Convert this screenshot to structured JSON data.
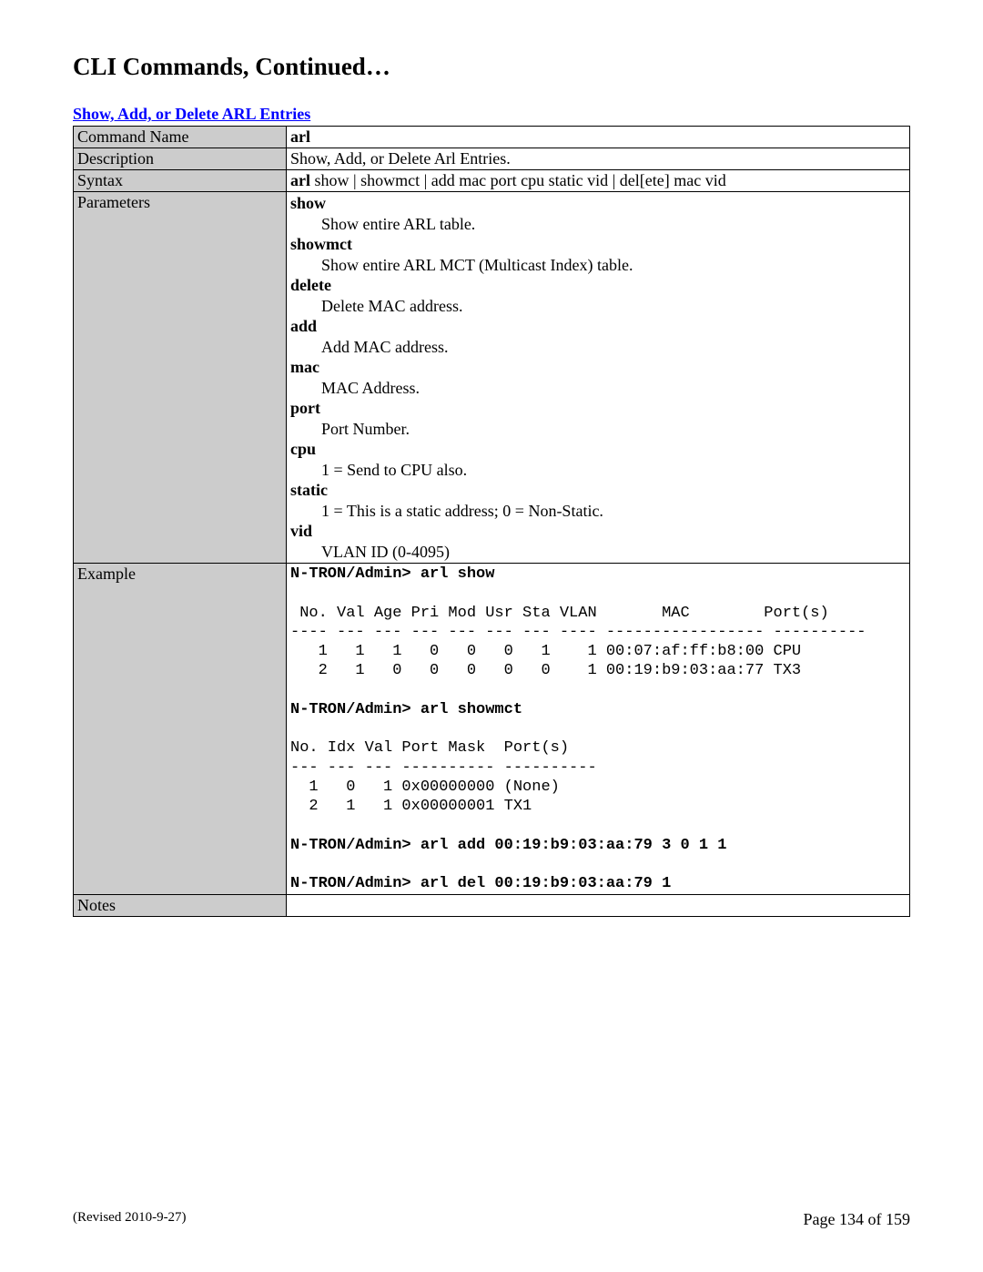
{
  "page_title": "CLI Commands, Continued…",
  "section_link": "Show, Add, or Delete ARL Entries",
  "rows": {
    "command_name": {
      "label": "Command Name",
      "value": "arl"
    },
    "description": {
      "label": "Description",
      "value": "Show, Add, or Delete Arl Entries."
    },
    "syntax": {
      "label": "Syntax",
      "bold": "arl",
      "rest": "  show | showmct | add mac port cpu static vid | del[ete] mac vid"
    },
    "parameters": {
      "label": "Parameters",
      "items": [
        {
          "name": "show",
          "desc": "Show entire ARL table."
        },
        {
          "name": "showmct",
          "desc": "Show entire ARL MCT (Multicast Index) table."
        },
        {
          "name": "delete",
          "desc": "Delete MAC address."
        },
        {
          "name": "add",
          "desc": "Add MAC address."
        },
        {
          "name": "mac",
          "desc": "MAC Address."
        },
        {
          "name": "port",
          "desc": "Port Number."
        },
        {
          "name": "cpu",
          "desc": "1 = Send to CPU also."
        },
        {
          "name": "static",
          "desc": "1 = This is a static address; 0 = Non-Static."
        },
        {
          "name": "vid",
          "desc": "VLAN ID (0-4095)"
        }
      ]
    },
    "example": {
      "label": "Example",
      "text": "N-TRON/Admin> arl show\n\n No. Val Age Pri Mod Usr Sta VLAN       MAC        Port(s)\n---- --- --- --- --- --- --- ---- ----------------- ----------\n   1   1   1   0   0   0   1    1 00:07:af:ff:b8:00 CPU\n   2   1   0   0   0   0   0    1 00:19:b9:03:aa:77 TX3\n\nN-TRON/Admin> arl showmct\n\nNo. Idx Val Port Mask  Port(s)\n--- --- --- ---------- ----------\n  1   0   1 0x00000000 (None)\n  2   1   1 0x00000001 TX1\n\nN-TRON/Admin> arl add 00:19:b9:03:aa:79 3 0 1 1\n\nN-TRON/Admin> arl del 00:19:b9:03:aa:79 1"
    },
    "notes": {
      "label": "Notes",
      "value": ""
    }
  },
  "footer": {
    "revised": "(Revised 2010-9-27)",
    "page": "Page 134 of 159"
  }
}
